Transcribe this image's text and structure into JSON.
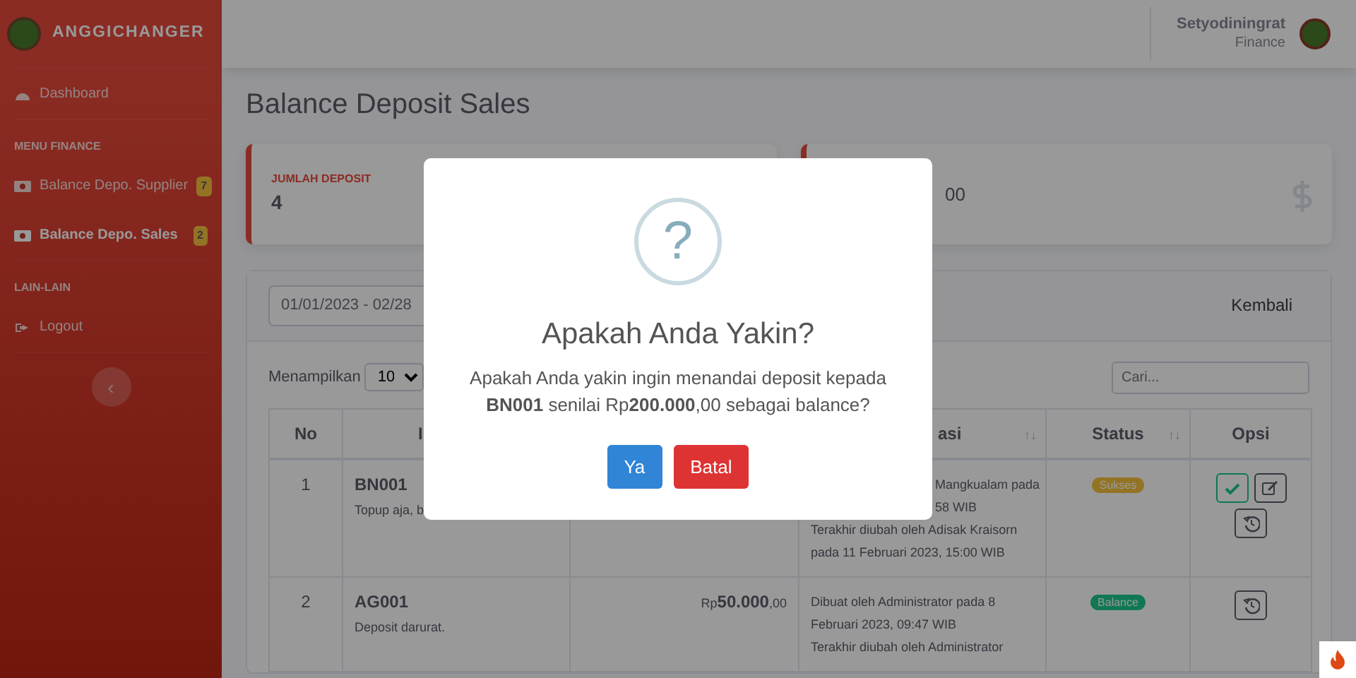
{
  "sidebar": {
    "brand": "ANGGICHANGER",
    "items": [
      {
        "kind": "divider"
      },
      {
        "kind": "link",
        "label": "Dashboard",
        "selected": false
      },
      {
        "kind": "divider"
      },
      {
        "kind": "heading",
        "label": "MENU FINANCE"
      },
      {
        "kind": "link",
        "label": "Balance Depo. Supplier",
        "badge": "7",
        "selected": false
      },
      {
        "kind": "link",
        "label": "Balance Depo. Sales",
        "badge": "2",
        "selected": true
      },
      {
        "kind": "divider"
      },
      {
        "kind": "heading",
        "label": "LAIN-LAIN"
      },
      {
        "kind": "link",
        "label": "Logout",
        "selected": false
      },
      {
        "kind": "divider"
      }
    ],
    "toggle": "‹"
  },
  "topbar": {
    "user_name": "Setyodiningrat",
    "user_role": "Finance"
  },
  "page_title": "Balance Deposit Sales",
  "stats": [
    {
      "label": "JUMLAH DEPOSIT",
      "value": "4"
    },
    {
      "value": "00"
    }
  ],
  "filter": {
    "date_range": "01/01/2023 - 02/28",
    "back_link": "Kembali"
  },
  "table_controls": {
    "length_label": "Menampilkan",
    "length_value": "10",
    "search_placeholder": "Cari..."
  },
  "table": {
    "columns": [
      {
        "label": "No"
      },
      {
        "label": "I"
      },
      {},
      {
        "label": "asi",
        "sort_icon": "↑↓"
      },
      {
        "label": "Status",
        "sort_icon": "↑↓"
      },
      {
        "label": "Opsi"
      }
    ],
    "rows": [
      {
        "no": "1",
        "id": "BN001",
        "note": "Topup aja, b",
        "info": [
          {
            "text": "Mangkualam pada",
            "covered": true
          },
          {
            "text": "58 WIB",
            "covered": true
          },
          {
            "text": "Terakhir diubah oleh Adisak Kraisorn pada 11 Februari 2023, 15:00 WIB"
          }
        ],
        "status": {
          "label": "Sukses",
          "kind": "warning"
        },
        "actions": [
          {
            "kind": "approve"
          },
          {
            "kind": "edit"
          },
          {
            "kind": "history"
          }
        ]
      },
      {
        "no": "2",
        "id": "AG001",
        "note": "Deposit darurat.",
        "amount": {
          "currency": "Rp",
          "major": "50.000",
          "minor": ",00"
        },
        "info": [
          {
            "text": "Dibuat oleh Administrator pada 8 Februari 2023, 09:47 WIB"
          },
          {
            "text": "Terakhir diubah oleh Administrator"
          }
        ],
        "status": {
          "label": "Balance",
          "kind": "success"
        },
        "actions": [
          {
            "kind": "history"
          }
        ]
      }
    ]
  },
  "modal": {
    "icon": "?",
    "title": "Apakah Anda Yakin?",
    "message": "Apakah Anda yakin ingin menandai deposit kepada **BN001** senilai Rp**200.000**,00 sebagai balance?",
    "buttons": [
      {
        "label": "Ya",
        "kind": "confirm"
      },
      {
        "label": "Batal",
        "kind": "cancel"
      }
    ]
  }
}
